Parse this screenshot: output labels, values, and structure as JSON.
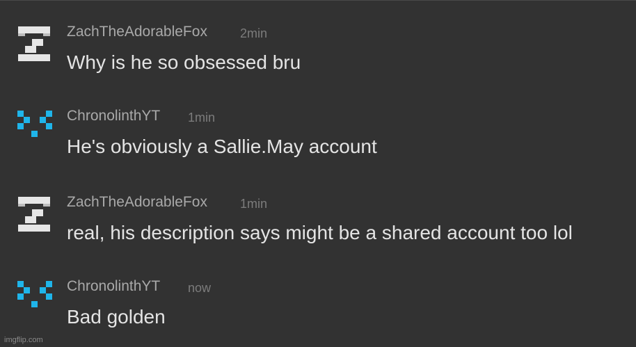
{
  "colors": {
    "background": "#323232",
    "username": "#a9a9a9",
    "timestamp": "#7c7c7c",
    "message": "#e4e4e4",
    "zach_avatar": "#e6e6e6",
    "chrono_avatar": "#1fb5ea"
  },
  "comments": [
    {
      "avatar_icon": "pixel-z-icon",
      "username": "ZachTheAdorableFox",
      "time": "2min",
      "message": "Why is he so obsessed bru"
    },
    {
      "avatar_icon": "pixel-cross-icon",
      "username": "ChronolinthYT",
      "time": "1min",
      "message": "He's obviously a Sallie.May account"
    },
    {
      "avatar_icon": "pixel-z-icon",
      "username": "ZachTheAdorableFox",
      "time": "1min",
      "message": "real, his description says might be a shared account too lol"
    },
    {
      "avatar_icon": "pixel-cross-icon",
      "username": "ChronolinthYT",
      "time": "now",
      "message": "Bad golden"
    }
  ],
  "watermark": "imgflip.com"
}
